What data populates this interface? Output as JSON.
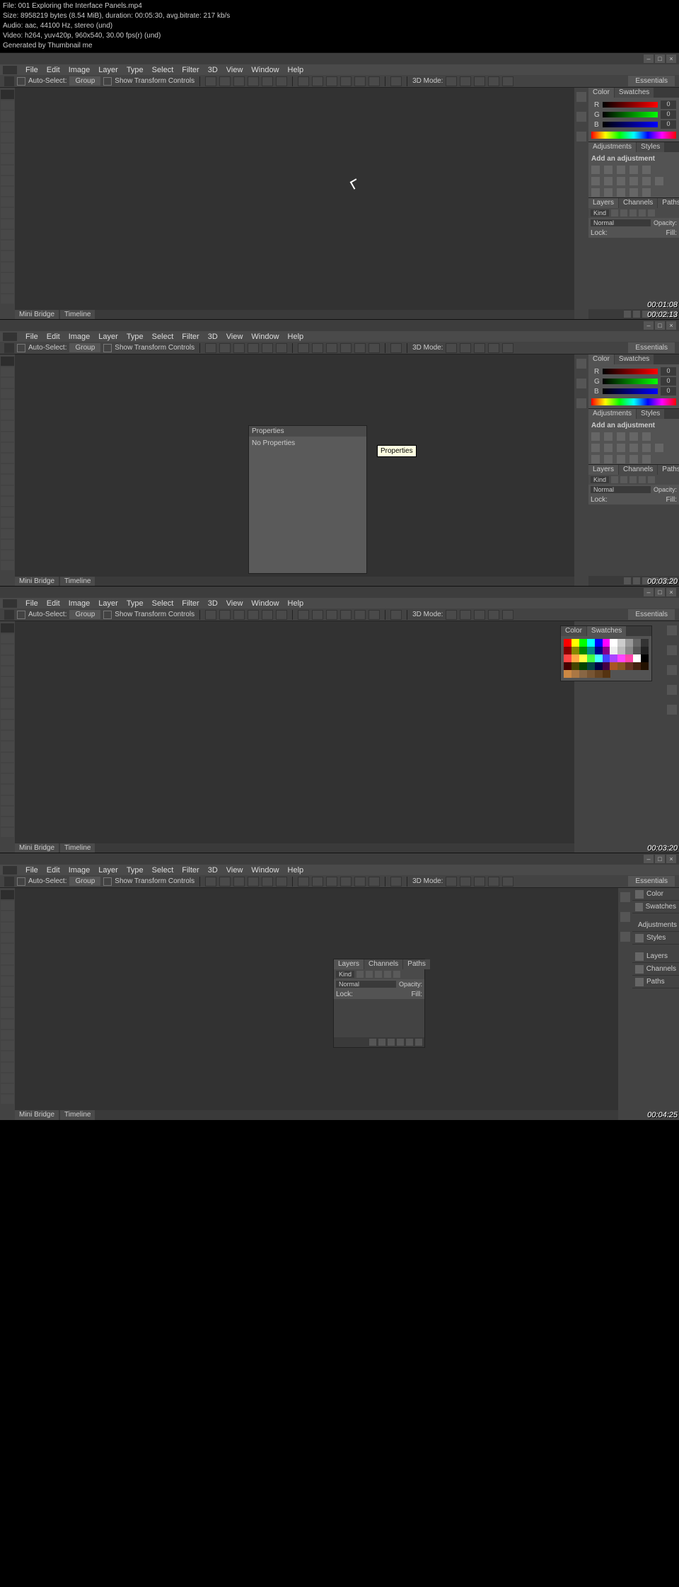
{
  "meta": {
    "line1": "File: 001 Exploring the Interface  Panels.mp4",
    "line2": "Size: 8958219 bytes (8.54 MiB), duration: 00:05:30, avg.bitrate: 217 kb/s",
    "line3": "Audio: aac, 44100 Hz, stereo (und)",
    "line4": "Video: h264, yuv420p, 960x540, 30.00 fps(r) (und)",
    "line5": "Generated by Thumbnail me"
  },
  "menu": [
    "File",
    "Edit",
    "Image",
    "Layer",
    "Type",
    "Select",
    "Filter",
    "3D",
    "View",
    "Window",
    "Help"
  ],
  "options": {
    "autoselect": "Auto-Select:",
    "group": "Group",
    "showtransform": "Show Transform Controls",
    "threedmode": "3D Mode:",
    "essentials": "Essentials"
  },
  "docktabs": {
    "mini": "Mini Bridge",
    "timeline": "Timeline"
  },
  "panels": {
    "color": "Color",
    "swatches": "Swatches",
    "adjustments": "Adjustments",
    "styles": "Styles",
    "addadjust": "Add an adjustment",
    "layers": "Layers",
    "channels": "Channels",
    "paths": "Paths",
    "kind": "Kind",
    "normal": "Normal",
    "opacity": "Opacity:",
    "lock": "Lock:",
    "fill": "Fill:",
    "rgb_r": "R",
    "rgb_g": "G",
    "rgb_b": "B",
    "rgb_val": "0"
  },
  "props": {
    "title": "Properties",
    "none": "No Properties",
    "tooltip": "Properties"
  },
  "timestamps": {
    "f1": "00:01:08",
    "f1b": "00:02:13",
    "f2": "00:03:20",
    "f3": "00:03:20",
    "f4": "00:04:25"
  },
  "collapsed": [
    "Color",
    "Swatches",
    "Adjustments",
    "Styles",
    "Layers",
    "Channels",
    "Paths"
  ]
}
